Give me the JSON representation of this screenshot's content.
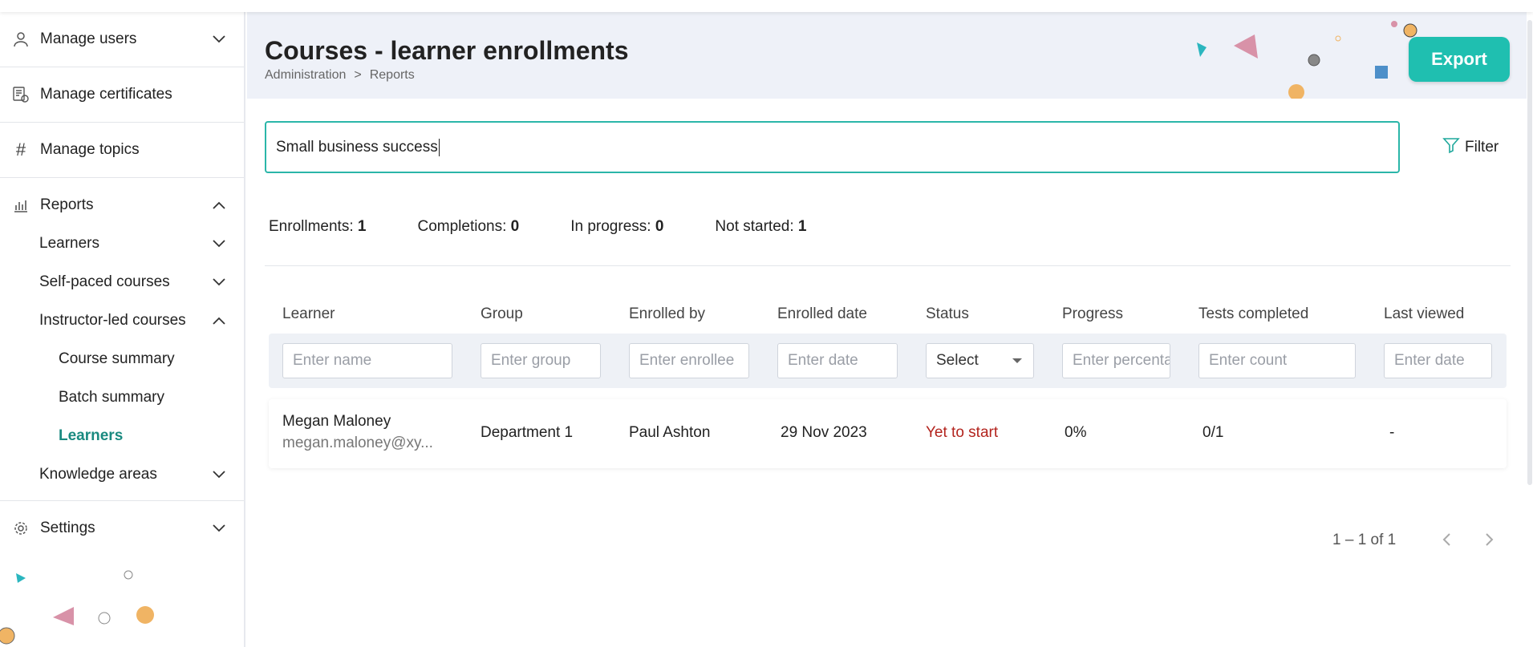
{
  "sidebar": {
    "manage_users": "Manage users",
    "manage_certificates": "Manage certificates",
    "manage_topics": "Manage topics",
    "reports": "Reports",
    "learners": "Learners",
    "self_paced": "Self-paced courses",
    "instructor_led": "Instructor-led courses",
    "course_summary": "Course summary",
    "batch_summary": "Batch summary",
    "il_learners": "Learners",
    "knowledge_areas": "Knowledge areas",
    "settings": "Settings"
  },
  "header": {
    "title": "Courses - learner enrollments",
    "breadcrumb": [
      "Administration",
      ">",
      "Reports"
    ],
    "export_label": "Export"
  },
  "search": {
    "value": "Small business success"
  },
  "filter_label": "Filter",
  "stats": [
    {
      "label": "Enrollments:",
      "value": "1"
    },
    {
      "label": "Completions:",
      "value": "0"
    },
    {
      "label": "In progress:",
      "value": "0"
    },
    {
      "label": "Not started:",
      "value": "1"
    }
  ],
  "table": {
    "columns": [
      "Learner",
      "Group",
      "Enrolled by",
      "Enrolled date",
      "Status",
      "Progress",
      "Tests completed",
      "Last viewed"
    ],
    "filters": [
      "Enter name",
      "Enter group",
      "Enter enrollee",
      "Enter date",
      "Select",
      "Enter percentage",
      "Enter count",
      "Enter date"
    ],
    "rows": [
      {
        "name": "Megan Maloney",
        "email": "megan.maloney@xy...",
        "group": "Department 1",
        "enrolled_by": "Paul Ashton",
        "enrolled_date": "29 Nov 2023",
        "status": "Yet to start",
        "progress": "0%",
        "tests_completed": "0/1",
        "last_viewed": "-"
      }
    ]
  },
  "pagination": {
    "text": "1 – 1 of 1"
  },
  "colors": {
    "accent": "#1fbfb0",
    "active_nav": "#1a8a80",
    "status_red": "#b3241e"
  },
  "icons": [
    "user-icon",
    "certificate-icon",
    "hash-icon",
    "chart-icon",
    "gear-icon",
    "chevron-down-icon",
    "chevron-up-icon",
    "filter-icon",
    "chevron-left-icon",
    "chevron-right-icon"
  ]
}
